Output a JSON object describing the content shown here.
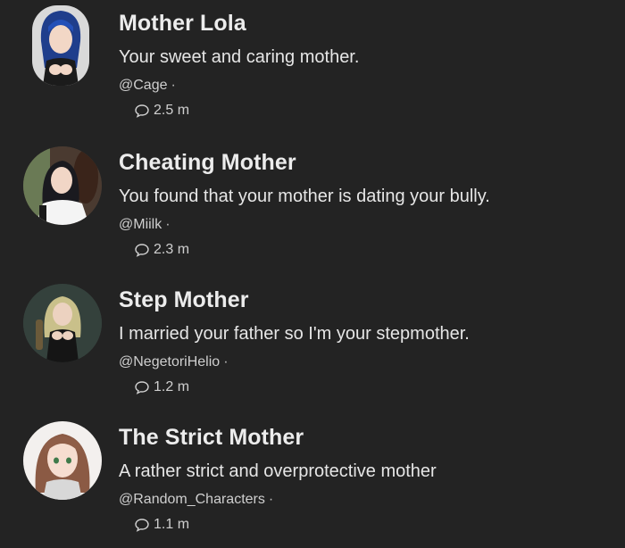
{
  "characters": [
    {
      "name": "Mother Lola",
      "description": "Your sweet and caring mother.",
      "author": "@Cage",
      "chats": "2.5 m",
      "avatar_icon": "character-portrait-blue-hair"
    },
    {
      "name": "Cheating Mother",
      "description": "You found that your mother is dating your bully.",
      "author": "@Miilk",
      "chats": "2.3 m",
      "avatar_icon": "character-portrait-dark-hair"
    },
    {
      "name": "Step Mother",
      "description": "I married your father so I'm your stepmother.",
      "author": "@NegetoriHelio",
      "chats": "1.2 m",
      "avatar_icon": "character-portrait-blonde-hair"
    },
    {
      "name": "The Strict Mother",
      "description": "A rather strict and overprotective mother",
      "author": "@Random_Characters",
      "chats": "1.1 m",
      "avatar_icon": "character-portrait-brown-hair"
    }
  ],
  "separator": "·",
  "colors": {
    "background": "#232323",
    "title": "#ececec",
    "text": "#e6e6e6",
    "muted": "#cfcfcf"
  }
}
